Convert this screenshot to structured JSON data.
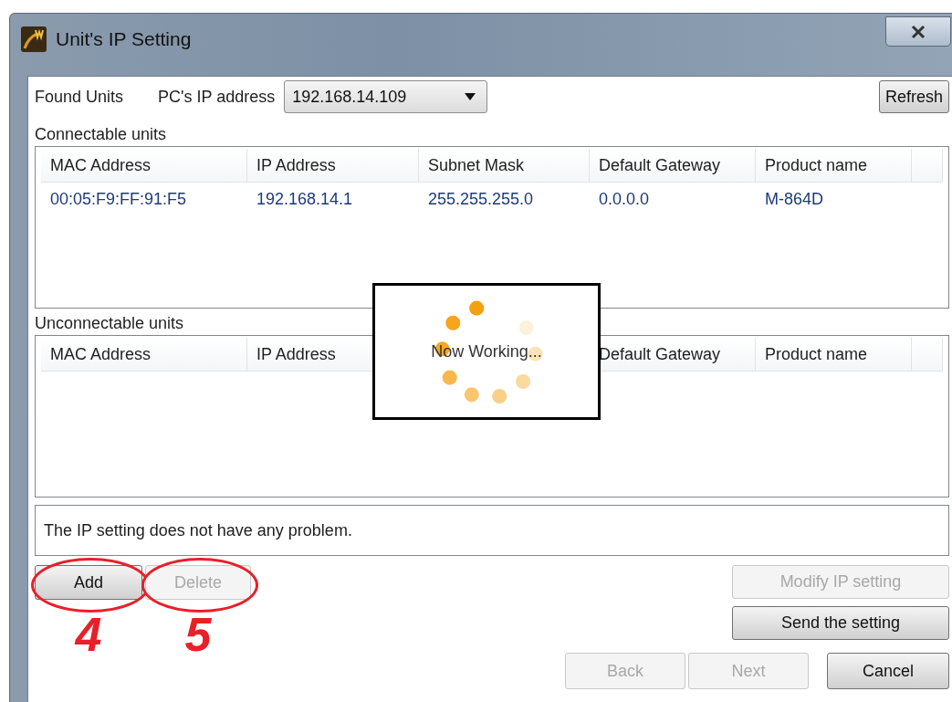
{
  "window": {
    "title": "Unit's IP Setting"
  },
  "found_units_label": "Found Units",
  "pc_ip": {
    "label": "PC's IP address",
    "value": "192.168.14.109"
  },
  "refresh_button": "Refresh",
  "connectable": {
    "title": "Connectable units",
    "columns": [
      "MAC Address",
      "IP Address",
      "Subnet Mask",
      "Default Gateway",
      "Product name"
    ],
    "rows": [
      [
        "00:05:F9:FF:91:F5",
        "192.168.14.1",
        "255.255.255.0",
        "0.0.0.0",
        "M-864D"
      ]
    ]
  },
  "unconnectable": {
    "title": "Unconnectable units",
    "columns": [
      "MAC Address",
      "IP Address",
      null,
      "Default Gateway",
      "Product name"
    ]
  },
  "progress_dialog": {
    "message": "Now Working..."
  },
  "status_message": "The IP setting does not have any problem.",
  "list_buttons": [
    {
      "label": "Add",
      "disabled": false,
      "callout": "4"
    },
    {
      "label": "Delete",
      "disabled": true,
      "callout": "5"
    }
  ],
  "setting_buttons": [
    {
      "label": "Modify IP setting",
      "disabled": true
    },
    {
      "label": "Send the setting",
      "disabled": false
    }
  ],
  "nav_buttons": [
    {
      "label": "Back",
      "disabled": true
    },
    {
      "label": "Next",
      "disabled": true
    },
    {
      "label": "Cancel",
      "disabled": false
    }
  ]
}
